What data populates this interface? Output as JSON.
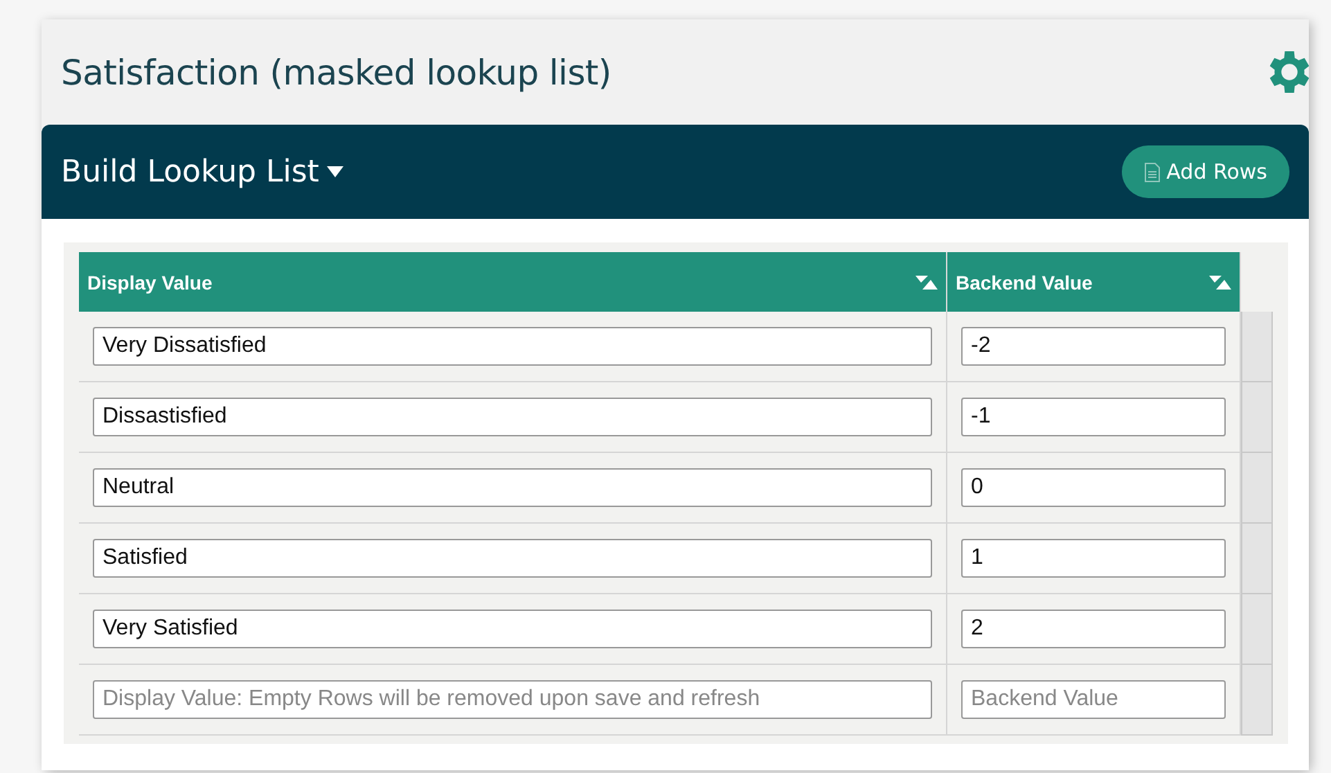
{
  "title": "Satisfaction (masked lookup list)",
  "panel": {
    "title": "Build Lookup List",
    "add_button": "Add Rows"
  },
  "table": {
    "columns": [
      "Display Value",
      "Backend Value"
    ],
    "rows": [
      {
        "display": "Very Dissatisfied",
        "backend": "-2"
      },
      {
        "display": "Dissastisfied",
        "backend": "-1"
      },
      {
        "display": "Neutral",
        "backend": "0"
      },
      {
        "display": "Satisfied",
        "backend": "1"
      },
      {
        "display": "Very Satisfied",
        "backend": "2"
      },
      {
        "display_placeholder": "Display Value: Empty Rows will be removed upon save and refresh",
        "backend_placeholder": "Backend Value"
      }
    ]
  }
}
